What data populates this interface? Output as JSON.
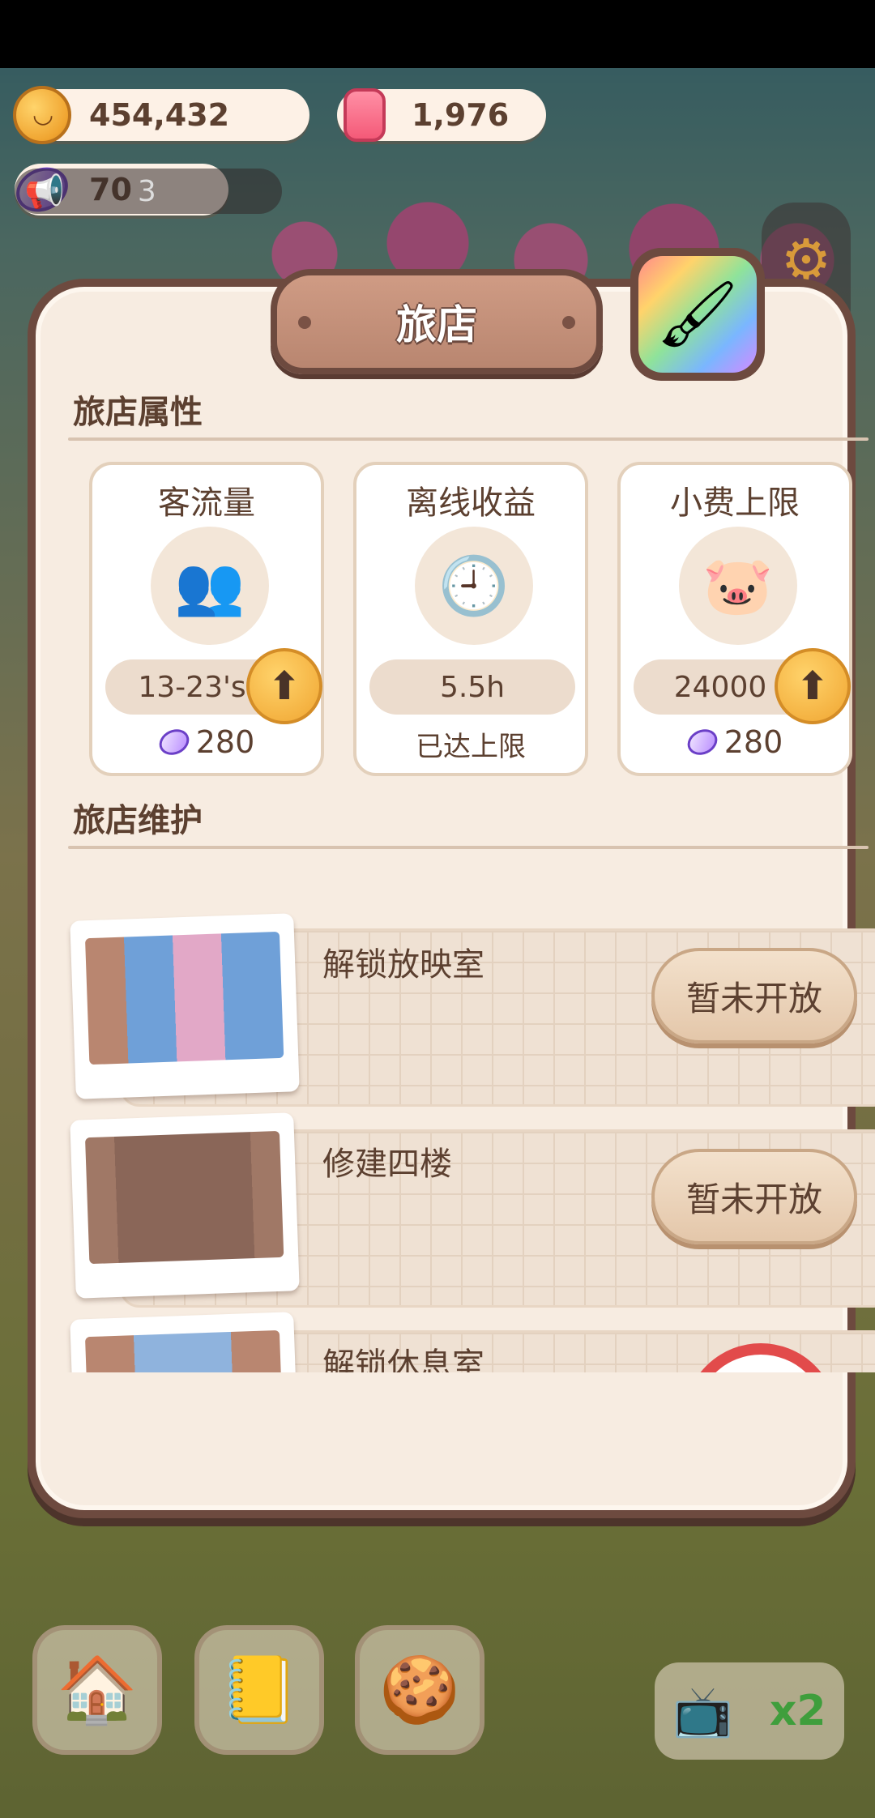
{
  "currencies": {
    "cookies": "454,432",
    "candles": "1,976",
    "gems": "70"
  },
  "announce": {
    "count": "3"
  },
  "panel": {
    "title": "旅店",
    "attributes_title": "旅店属性",
    "attributes": [
      {
        "name": "客流量",
        "value": "13-23's",
        "cost": "280",
        "icon": "customers-icon"
      },
      {
        "name": "离线收益",
        "value": "5.5h",
        "cost": "已达上限",
        "icon": "clock-cookie-icon"
      },
      {
        "name": "小费上限",
        "value": "24000",
        "cost": "280",
        "icon": "piggy-bank-icon"
      }
    ],
    "maintenance_title": "旅店维护",
    "maintenance": [
      {
        "label": "解锁放映室",
        "button": "暂未开放"
      },
      {
        "label": "修建四楼",
        "button": "暂未开放"
      },
      {
        "label": "解锁休息室",
        "button": ""
      }
    ]
  },
  "bottom": {
    "multiplier": "x2"
  },
  "colors": {
    "panel_border": "#6d4a3f",
    "panel_bg": "#f7ece1",
    "accent": "#f0a531"
  }
}
